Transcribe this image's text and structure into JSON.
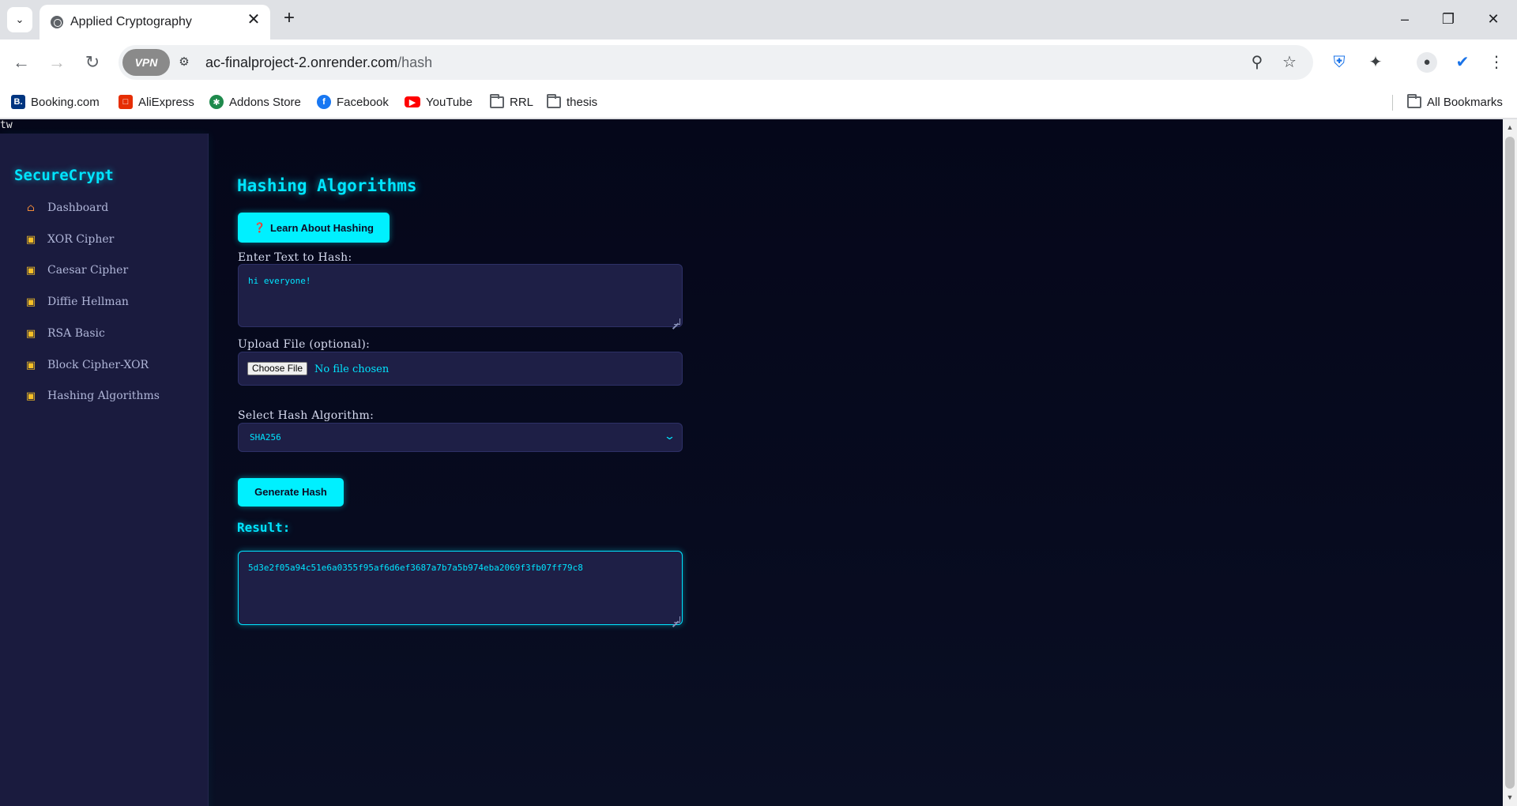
{
  "browser": {
    "tab_title": "Applied Cryptography",
    "url_host": "ac-finalproject-2.onrender.com",
    "url_path": "/hash",
    "vpn_label": "VPN",
    "bookmarks": [
      {
        "label": "Booking.com",
        "icon": "booking-icon",
        "color": "#003580"
      },
      {
        "label": "AliExpress",
        "icon": "aliexpress-icon",
        "color": "#e62e04"
      },
      {
        "label": "Addons Store",
        "icon": "addons-store-icon",
        "color": "#1f8a4c"
      },
      {
        "label": "Facebook",
        "icon": "facebook-icon",
        "color": "#1877f2"
      },
      {
        "label": "YouTube",
        "icon": "youtube-icon",
        "color": "#ff0000"
      },
      {
        "label": "RRL",
        "icon": "folder-icon"
      },
      {
        "label": "thesis",
        "icon": "folder-icon"
      }
    ],
    "all_bookmarks_label": "All Bookmarks"
  },
  "page": {
    "stray_text": "tw",
    "brand": "SecureCrypt",
    "nav": [
      {
        "label": "Dashboard",
        "icon": "house-icon"
      },
      {
        "label": "XOR Cipher",
        "icon": "lock-icon"
      },
      {
        "label": "Caesar Cipher",
        "icon": "lock-icon"
      },
      {
        "label": "Diffie Hellman",
        "icon": "lock-icon"
      },
      {
        "label": "RSA Basic",
        "icon": "lock-icon"
      },
      {
        "label": "Block Cipher-XOR",
        "icon": "lock-icon"
      },
      {
        "label": "Hashing Algorithms",
        "icon": "lock-icon"
      }
    ],
    "title": "Hashing Algorithms",
    "learn_button": "Learn About Hashing",
    "text_label": "Enter Text to Hash:",
    "text_value": "hi everyone!",
    "file_label": "Upload File (optional):",
    "choose_file": "Choose File",
    "no_file": "No file chosen",
    "algo_label": "Select Hash Algorithm:",
    "algo_value": "SHA256",
    "generate_button": "Generate Hash",
    "result_label": "Result:",
    "result_value": "5d3e2f05a94c51e6a0355f95af6d6ef3687a7b7a5b974eba2069f3fb07ff79c8"
  },
  "colors": {
    "accent": "#00e5ff",
    "sidebar_bg": "#1a1b3e",
    "page_bg": "#05071a",
    "input_bg": "#1e1f46",
    "lock": "#f6c026"
  }
}
